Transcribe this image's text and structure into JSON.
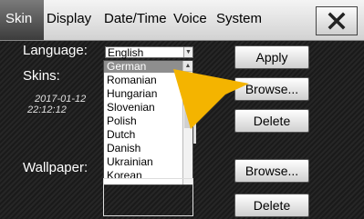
{
  "tabs": [
    {
      "label": "Skin",
      "active": true
    },
    {
      "label": "Display",
      "active": false
    },
    {
      "label": "Date/Time",
      "active": false
    },
    {
      "label": "Voice",
      "active": false
    },
    {
      "label": "System",
      "active": false
    }
  ],
  "close_label": "✕",
  "language": {
    "label": "Language:",
    "selected": "English",
    "options": [
      "German",
      "Romanian",
      "Hungarian",
      "Slovenian",
      "Polish",
      "Dutch",
      "Danish",
      "Ukrainian",
      "Korean"
    ],
    "highlighted": "German"
  },
  "skins": {
    "label": "Skins:",
    "date": "2017-01-12",
    "time": "22:12:12"
  },
  "wallpaper": {
    "label": "Wallpaper:"
  },
  "buttons": {
    "apply": "Apply",
    "browse_skin": "Browse...",
    "delete_skin": "Delete",
    "browse_wallpaper": "Browse...",
    "delete_wallpaper": "Delete"
  },
  "colors": {
    "accent_arrow": "#f4b400"
  },
  "icons": {
    "close": "close-icon",
    "pointer": "pointer-arrow-icon"
  }
}
